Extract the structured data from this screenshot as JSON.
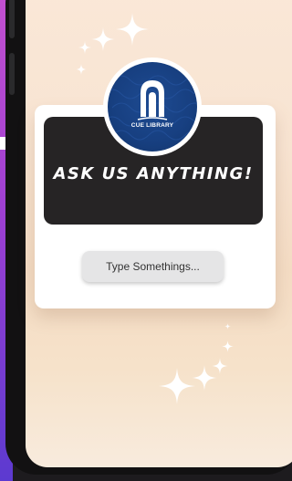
{
  "app": {
    "logo_text": "CUE LIBRARY",
    "headline": "ASK US ANYTHING!"
  },
  "input": {
    "placeholder": "Type Somethings..."
  },
  "icons": {
    "logo": "library-arch-logo-icon",
    "sparkles": "sparkle-icon"
  },
  "colors": {
    "banner": "#262425",
    "logo_blue": "#173f80",
    "background_peach": "#f8e4d2",
    "side_purple": "#9d3fd2"
  }
}
